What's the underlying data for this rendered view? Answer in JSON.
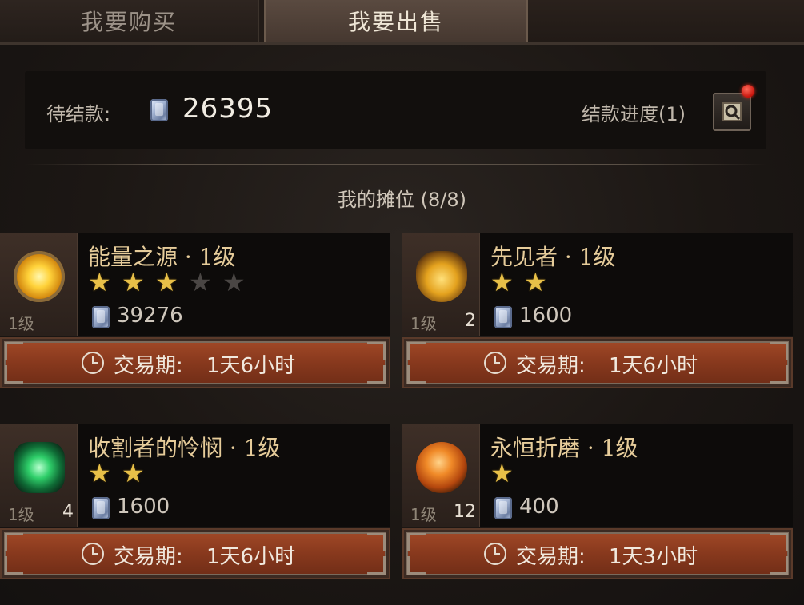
{
  "tabs": {
    "buy": "我要购买",
    "sell": "我要出售"
  },
  "pending": {
    "label": "待结款:",
    "amount": "26395",
    "progress_label": "结款进度(1)"
  },
  "stall": {
    "title": "我的摊位 (8/8)"
  },
  "period_label": "交易期:",
  "items": [
    {
      "name": "能量之源 · 1级",
      "level": "1级",
      "count": "",
      "stars": 3,
      "max_stars": 5,
      "price": "39276",
      "period": "1天6小时",
      "icon": "energy-gem-icon"
    },
    {
      "name": "先见者 · 1级",
      "level": "1级",
      "count": "2",
      "stars": 2,
      "max_stars": 2,
      "price": "1600",
      "period": "1天6小时",
      "icon": "seer-gem-icon"
    },
    {
      "name": "收割者的怜悯 · 1级",
      "level": "1级",
      "count": "4",
      "stars": 2,
      "max_stars": 2,
      "price": "1600",
      "period": "1天6小时",
      "icon": "reaper-gem-icon"
    },
    {
      "name": "永恒折磨 · 1级",
      "level": "1级",
      "count": "12",
      "stars": 1,
      "max_stars": 1,
      "price": "400",
      "period": "1天3小时",
      "icon": "torment-gem-icon"
    }
  ],
  "colors": {
    "accent": "#e6cc9a",
    "bar": "#8a3a1e",
    "star_on": "#e8c048",
    "star_off": "#4a4644"
  }
}
